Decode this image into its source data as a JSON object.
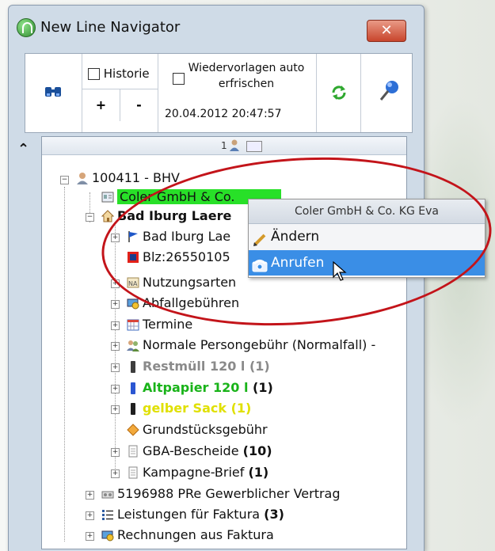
{
  "window": {
    "title": "New Line Navigator",
    "close_label": "✕"
  },
  "toolbar": {
    "historie_label": "Historie",
    "plus_label": "+",
    "minus_label": "-",
    "wiedervorlagen_label": "Wiedervorlagen auto erfrischen",
    "datetime": "20.04.2012 20:47:57"
  },
  "tree": {
    "header_num": "1",
    "root": "100411 - BHV",
    "highlight": "Coler GmbH & Co.",
    "bad_iburg": "Bad Iburg Laere",
    "bad_iburg_sub": "Bad Iburg Lae",
    "blz": "Blz:26550105",
    "nutzungsarten": "Nutzungsarten",
    "abfallgebuehren": "Abfallgebühren",
    "termine": "Termine",
    "personengebuehr": "Normale Persongebühr (Normalfall) -",
    "restmuell": "Restmüll 120 l",
    "restmuell_count": "(1)",
    "altpapier": "Altpapier 120 l",
    "altpapier_count": "(1)",
    "gelber": "gelber Sack",
    "gelber_count": "(1)",
    "grundstueck": "Grundstücksgebühr",
    "gba": "GBA-Bescheide",
    "gba_count": "(10)",
    "kampagne": "Kampagne-Brief",
    "kampagne_count": "(1)",
    "gewerblich": "5196988 PRe  Gewerblicher Vertrag",
    "leistungen": "Leistungen für Faktura",
    "leistungen_count": "(3)",
    "rechnungen": "Rechnungen aus Faktura"
  },
  "context_menu": {
    "header": "Coler GmbH & Co. KG Eva",
    "items": [
      {
        "label": "Ändern",
        "icon": "pencil-icon"
      },
      {
        "label": "Anrufen",
        "icon": "phone-icon",
        "selected": true
      }
    ]
  },
  "colors": {
    "highlight": "#28e028",
    "selection": "#3a8ee6",
    "oval": "#c3141a",
    "altpapier": "#19b319",
    "gelber": "#e0e000"
  }
}
